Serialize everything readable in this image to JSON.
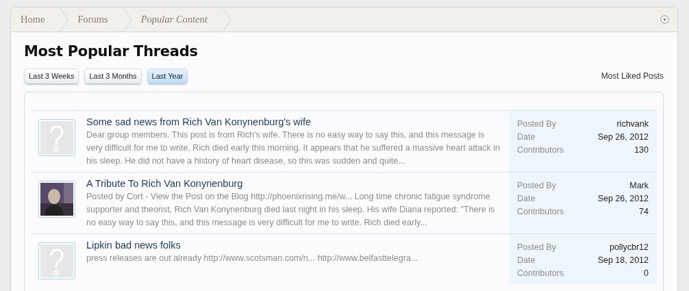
{
  "breadcrumb": [
    {
      "label": "Home",
      "current": false
    },
    {
      "label": "Forums",
      "current": false
    },
    {
      "label": "Popular Content",
      "current": true
    }
  ],
  "title": "Most Popular Threads",
  "filters": [
    {
      "label": "Last 3 Weeks",
      "selected": false
    },
    {
      "label": "Last 3 Months",
      "selected": false
    },
    {
      "label": "Last Year",
      "selected": true
    }
  ],
  "side_link": "Most Liked Posts",
  "threads": [
    {
      "avatar": {
        "kind": "placeholder"
      },
      "title": "Some sad news from Rich Van Konynenburg's wife",
      "snippet": "Dear group members. This post is from Rich's wife. There is no easy way to say this, and this message is very difficult for me to write. Rich died early this morning. It appears that he suffered a massive heart attack in his sleep. He did not have a history of heart disease, so this was sudden and quite...",
      "meta": [
        {
          "label": "Posted By",
          "value": "richvank"
        },
        {
          "label": "Date",
          "value": "Sep 26, 2012"
        },
        {
          "label": "Contributors",
          "value": "130"
        }
      ]
    },
    {
      "title": "A Tribute To Rich Van Konynenburg",
      "snippet": "Posted by Cort - View the Post on the Blog http://phoenixrising.me/w... Long time chronic fatigue syndrome supporter and theorist, Rich Van Konynenburg died last night in his sleep. His wife Diana reported: \"There is no easy way to say this, and this message is very difficult for me to write. Rich died early...",
      "meta": [
        {
          "label": "Posted By",
          "value": "Mark"
        },
        {
          "label": "Date",
          "value": "Sep 26, 2012"
        },
        {
          "label": "Contributors",
          "value": "74"
        }
      ]
    },
    {
      "avatar": {
        "kind": "placeholder"
      },
      "title": "Lipkin bad news folks",
      "snippet": "press releases are out already http://www.scotsman.com/n... http://www.belfasttelegra...",
      "meta": [
        {
          "label": "Posted By",
          "value": "pollycbr12"
        },
        {
          "label": "Date",
          "value": "Sep 18, 2012"
        },
        {
          "label": "Contributors",
          "value": "0"
        }
      ]
    }
  ]
}
